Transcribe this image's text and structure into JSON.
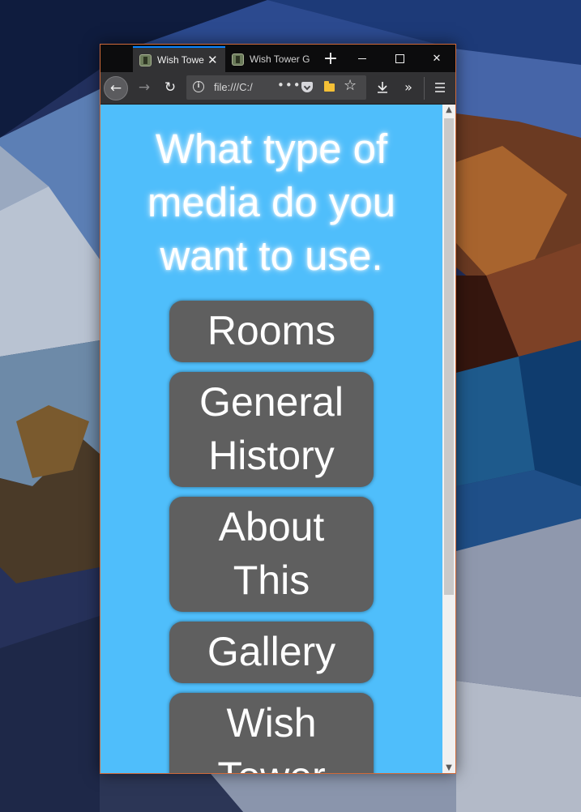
{
  "browser": {
    "tabs": [
      {
        "title": "Wish Tower Guide",
        "close": "✕"
      },
      {
        "title": "Wish Tower Guide"
      }
    ],
    "new_tab_label": "+",
    "window_controls": {
      "minimize": "—",
      "maximize": "☐",
      "close": "✕"
    },
    "address_bar": {
      "url": "file:///C:/",
      "page_actions": "•••"
    },
    "icons": [
      "back-arrow-icon",
      "forward-arrow-icon",
      "reload-icon",
      "info-icon",
      "pocket-icon",
      "folder-icon",
      "bookmark-star-icon",
      "download-icon",
      "overflow-chevron-icon",
      "hamburger-menu-icon"
    ]
  },
  "page": {
    "heading_lines": [
      "What type of",
      "media do you",
      "want to use."
    ],
    "buttons": [
      {
        "lines": [
          "Rooms"
        ]
      },
      {
        "lines": [
          "General",
          "History"
        ]
      },
      {
        "lines": [
          "About",
          "This"
        ]
      },
      {
        "lines": [
          "Gallery"
        ]
      },
      {
        "lines": [
          "Wish",
          "Tower"
        ]
      }
    ],
    "background_color": "#4fbefb",
    "button_color": "#5f5f5f"
  }
}
